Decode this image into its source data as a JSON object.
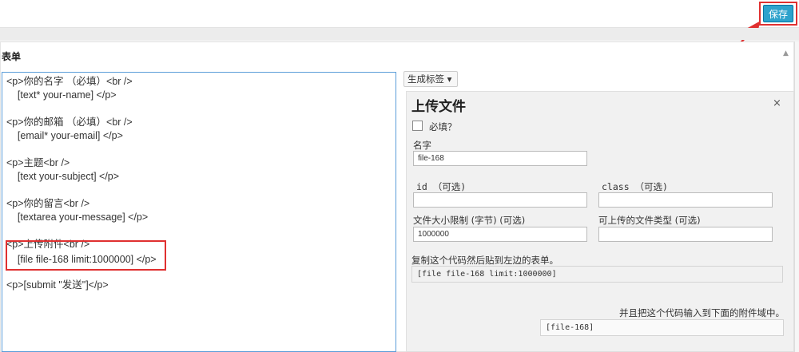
{
  "toolbar": {
    "save_label": "保存"
  },
  "panel": {
    "title": "表单",
    "collapse_icon": "▲"
  },
  "form_code": [
    "<p>你的名字 （必填）<br />",
    "    [text* your-name] </p>",
    "<p>你的邮箱 （必填）<br />",
    "    [email* your-email] </p>",
    "<p>主题<br />",
    "    [text your-subject] </p>",
    "<p>你的留言<br />",
    "    [textarea your-message] </p>",
    "<p>上传附件<br />",
    "    [file file-168 limit:1000000] </p>",
    "<p>[submit \"发送\"]</p>"
  ],
  "tag_generator": {
    "button_label": "生成标签 ▾",
    "title": "上传文件",
    "close": "×",
    "required_label": "必填？",
    "name_label": "名字",
    "name_value": "file-168",
    "id_label": "id （可选)",
    "id_value": "",
    "class_label": "class （可选)",
    "class_value": "",
    "size_label": "文件大小限制 (字节) (可选)",
    "size_value": "1000000",
    "types_label": "可上传的文件类型 (可选)",
    "types_value": "",
    "copy_hint": "复制这个代码然后贴到左边的表单。",
    "tag_code": "[file file-168 limit:1000000]",
    "mail_hint": "并且把这个代码输入到下面的附件域中。",
    "mail_code": "[file-168]"
  },
  "colors": {
    "accent": "#2ea2cc",
    "highlight": "#e03030",
    "editor_border": "#5b9dd9"
  }
}
